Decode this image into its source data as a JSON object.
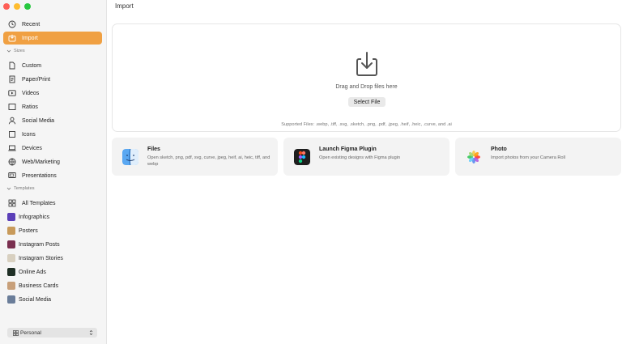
{
  "window": {
    "title": "Import"
  },
  "sidebar": {
    "top_items": [
      {
        "label": "Recent",
        "icon": "clock-icon"
      },
      {
        "label": "Import",
        "icon": "import-icon",
        "active": true
      }
    ],
    "sizes_heading": "Sizes",
    "sizes": [
      {
        "label": "Custom",
        "icon": "document-icon"
      },
      {
        "label": "Paper/Print",
        "icon": "paper-icon"
      },
      {
        "label": "Videos",
        "icon": "video-icon"
      },
      {
        "label": "Ratios",
        "icon": "ratio-icon"
      },
      {
        "label": "Social Media",
        "icon": "person-icon"
      },
      {
        "label": "Icons",
        "icon": "square-icon"
      },
      {
        "label": "Devices",
        "icon": "laptop-icon"
      },
      {
        "label": "Web/Marketing",
        "icon": "globe-icon"
      },
      {
        "label": "Presentations",
        "icon": "presentation-icon"
      }
    ],
    "templates_heading": "Templates",
    "templates": [
      {
        "label": "All Templates",
        "icon": "grid-icon"
      },
      {
        "label": "Infographics",
        "thumb": "#5b3fb8"
      },
      {
        "label": "Posters",
        "thumb": "#c89a5a"
      },
      {
        "label": "Instagram Posts",
        "thumb": "#7a2f4f"
      },
      {
        "label": "Instagram Stories",
        "thumb": "#d8d0c0"
      },
      {
        "label": "Online Ads",
        "thumb": "#1f2f25"
      },
      {
        "label": "Business Cards",
        "thumb": "#c8a07a"
      },
      {
        "label": "Social Media",
        "thumb": "#6a7d99"
      }
    ],
    "workspace": "Personal"
  },
  "dropzone": {
    "text": "Drag and Drop files here",
    "button": "Select File",
    "supported": "Supported Files: .webp, .tiff, .svg, .sketch, .png, .pdf, .jpeg, .heif, .heic, .curve, and .ai"
  },
  "cards": [
    {
      "title": "Files",
      "desc": "Open sketch, png, pdf, svg, curve, jpeg, heif, ai, heic, tiff, and webp",
      "icon": "finder-icon"
    },
    {
      "title": "Launch Figma Plugin",
      "desc": "Open existing designs with Figma plugin",
      "icon": "figma-icon"
    },
    {
      "title": "Photo",
      "desc": "Import photos from your Camera Roll",
      "icon": "photos-icon"
    }
  ],
  "colors": {
    "accent": "#f0a042",
    "sidebar_bg": "#f5f5f5",
    "card_bg": "#f3f3f3"
  }
}
